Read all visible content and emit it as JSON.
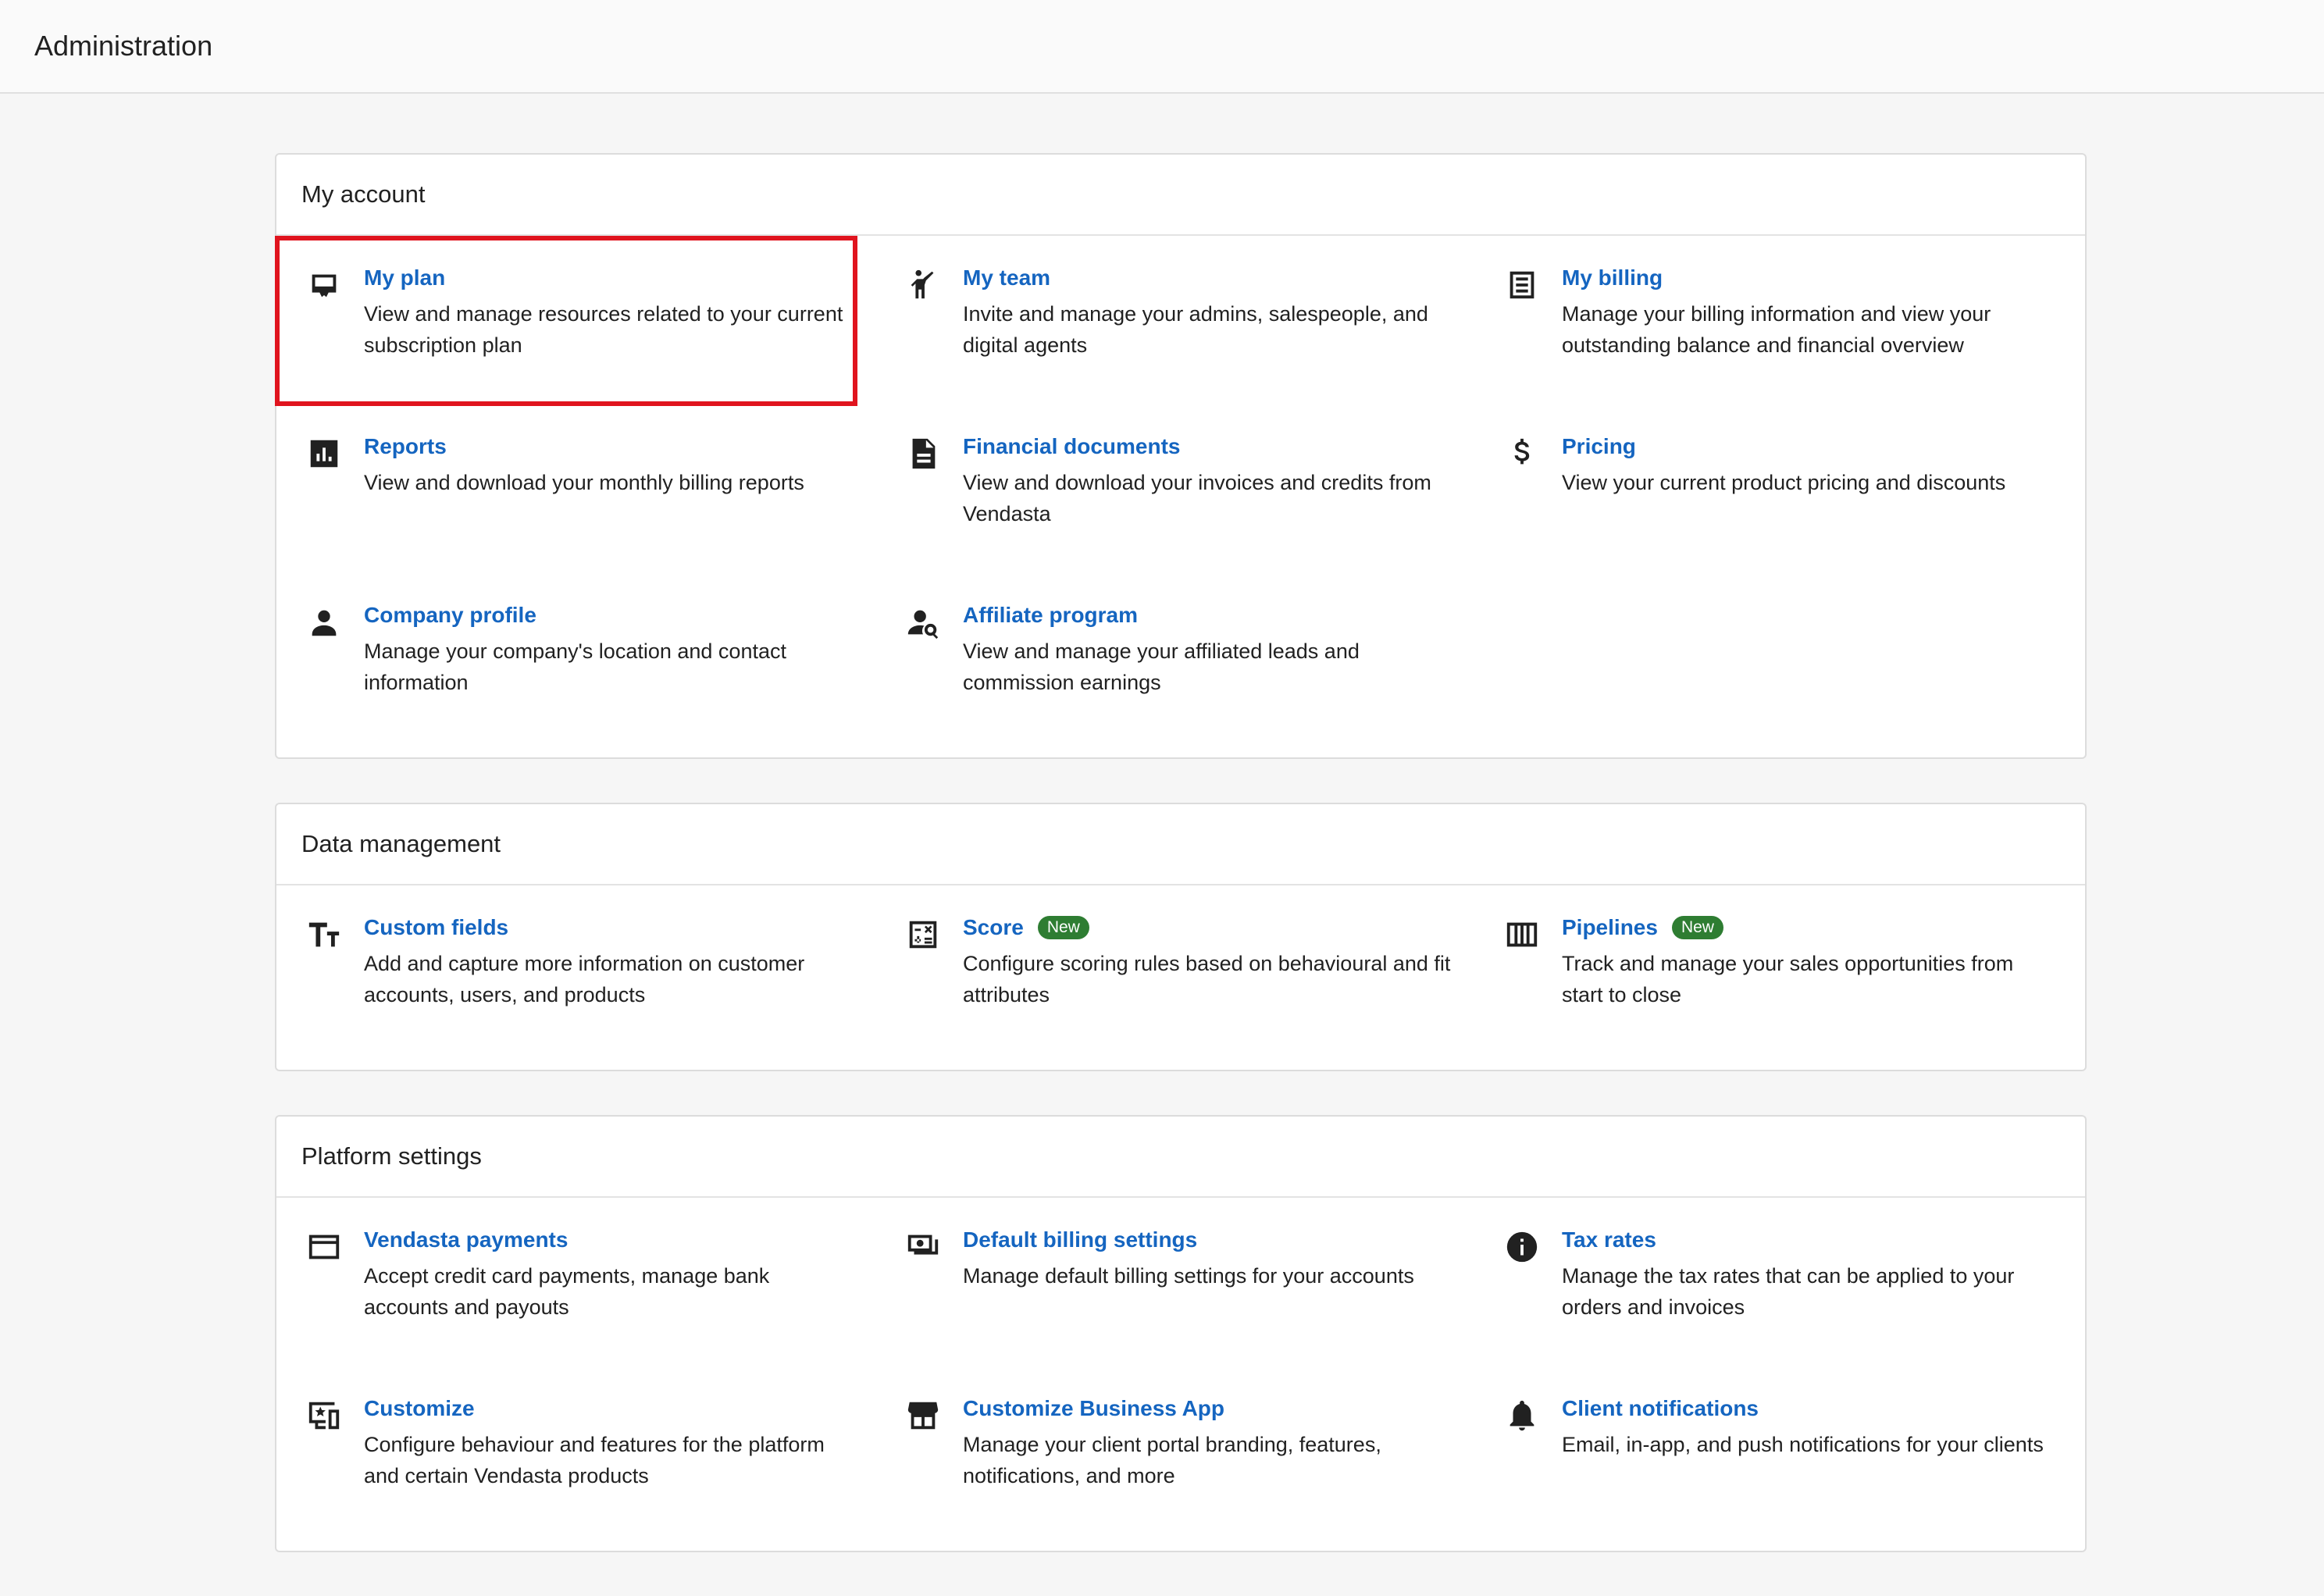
{
  "header": {
    "title": "Administration"
  },
  "sections": [
    {
      "title": "My account",
      "items": [
        {
          "icon": "plan-card-icon",
          "title": "My plan",
          "desc": "View and manage resources related to your current subscription plan",
          "badge": ""
        },
        {
          "icon": "team-person-icon",
          "title": "My team",
          "desc": "Invite and manage your admins, salespeople, and digital agents",
          "badge": ""
        },
        {
          "icon": "receipt-icon",
          "title": "My billing",
          "desc": "Manage your billing information and view your outstanding balance and financial overview",
          "badge": ""
        },
        {
          "icon": "bar-chart-icon",
          "title": "Reports",
          "desc": "View and download your monthly billing reports",
          "badge": ""
        },
        {
          "icon": "document-icon",
          "title": "Financial documents",
          "desc": "View and download your invoices and credits from Vendasta",
          "badge": ""
        },
        {
          "icon": "dollar-icon",
          "title": "Pricing",
          "desc": "View your current product pricing and discounts",
          "badge": ""
        },
        {
          "icon": "person-icon",
          "title": "Company profile",
          "desc": "Manage your company's location and contact information",
          "badge": ""
        },
        {
          "icon": "person-search-icon",
          "title": "Affiliate program",
          "desc": "View and manage your affiliated leads and commission earnings",
          "badge": ""
        }
      ]
    },
    {
      "title": "Data management",
      "items": [
        {
          "icon": "text-fields-icon",
          "title": "Custom fields",
          "desc": "Add and capture more information on customer accounts, users, and products",
          "badge": ""
        },
        {
          "icon": "calculator-icon",
          "title": "Score",
          "desc": "Configure scoring rules based on behavioural and fit attributes",
          "badge": "New"
        },
        {
          "icon": "columns-icon",
          "title": "Pipelines",
          "desc": "Track and manage your sales opportunities from start to close",
          "badge": "New"
        }
      ]
    },
    {
      "title": "Platform settings",
      "items": [
        {
          "icon": "credit-card-icon",
          "title": "Vendasta payments",
          "desc": "Accept credit card payments, manage bank accounts and payouts",
          "badge": ""
        },
        {
          "icon": "payments-icon",
          "title": "Default billing settings",
          "desc": "Manage default billing settings for your accounts",
          "badge": ""
        },
        {
          "icon": "info-icon",
          "title": "Tax rates",
          "desc": "Manage the tax rates that can be applied to your orders and invoices",
          "badge": ""
        },
        {
          "icon": "devices-star-icon",
          "title": "Customize",
          "desc": "Configure behaviour and features for the platform and certain Vendasta products",
          "badge": ""
        },
        {
          "icon": "storefront-icon",
          "title": "Customize Business App",
          "desc": "Manage your client portal branding, features, notifications, and more",
          "badge": ""
        },
        {
          "icon": "bell-icon",
          "title": "Client notifications",
          "desc": "Email, in-app, and push notifications for your clients",
          "badge": ""
        }
      ]
    }
  ]
}
